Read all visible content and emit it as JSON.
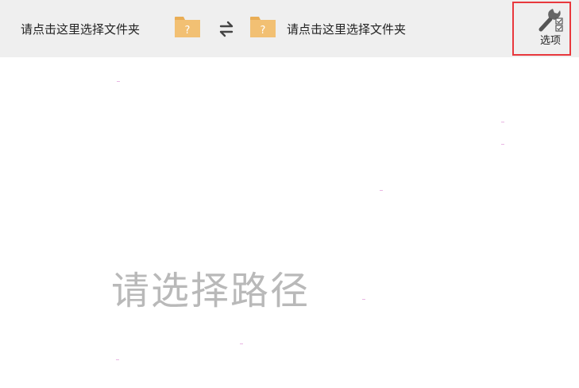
{
  "toolbar": {
    "left_path_label": "请点击这里选择文件夹",
    "right_path_label": "请点击这里选择文件夹",
    "folder_badge": "?",
    "options_label": "选项"
  },
  "main": {
    "placeholder": "请选择路径"
  },
  "colors": {
    "toolbar_bg": "#efefef",
    "folder": "#f2c073",
    "highlight": "#e8383d",
    "placeholder_text": "#b9b9b9"
  },
  "icons": {
    "folder": "folder-question-icon",
    "swap": "swap-arrows-icon",
    "options": "wrench-checklist-icon"
  }
}
